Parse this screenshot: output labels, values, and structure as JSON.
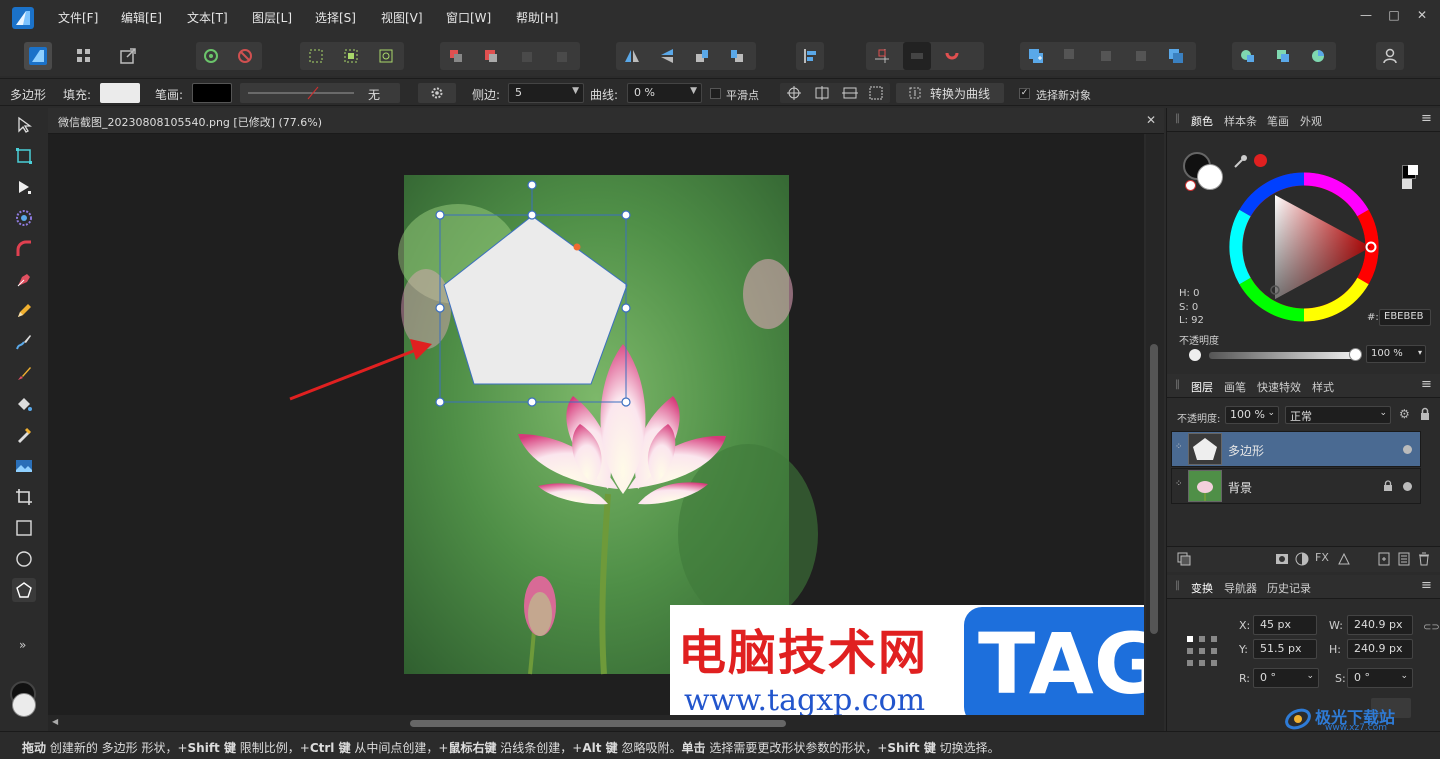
{
  "menubar": {
    "items": [
      "文件[F]",
      "编辑[E]",
      "文本[T]",
      "图层[L]",
      "选择[S]",
      "视图[V]",
      "窗口[W]",
      "帮助[H]"
    ],
    "window_controls": {
      "minimize": "—",
      "maximize": "□",
      "close": "✕"
    }
  },
  "context_bar": {
    "tool_name": "多边形",
    "fill_label": "填充:",
    "stroke_label": "笔画:",
    "stroke_style_value": "无",
    "sides_label": "侧边:",
    "sides_value": "5",
    "curve_label": "曲线:",
    "curve_value": "0 %",
    "smooth_points_label": "平滑点",
    "convert_to_curves_label": "转换为曲线",
    "select_new_object_label": "选择新对象",
    "fill_color": "#ebebeb",
    "stroke_color": "#000000"
  },
  "document": {
    "tab_title": "微信截图_20230808105540.png [已修改] (77.6%)",
    "close_icon": "✕"
  },
  "color_panel": {
    "tabs": [
      "颜色",
      "样本条",
      "笔画",
      "外观"
    ],
    "hsl": {
      "h": "H: 0",
      "s": "S: 0",
      "l": "L: 92"
    },
    "hex_label": "#:",
    "hex_value": "EBEBEB",
    "opacity_label": "不透明度",
    "opacity_value": "100 %",
    "accent": "#e02020"
  },
  "layers_panel": {
    "tabs": [
      "图层",
      "画笔",
      "快速特效",
      "样式"
    ],
    "opacity_label": "不透明度:",
    "opacity_value": "100 %",
    "blend_mode": "正常",
    "layers": [
      {
        "name": "多边形",
        "selected": true
      },
      {
        "name": "背景",
        "selected": false,
        "locked": true
      }
    ]
  },
  "transform_panel": {
    "tabs": [
      "变换",
      "导航器",
      "历史记录"
    ],
    "x_label": "X:",
    "x_value": "45 px",
    "y_label": "Y:",
    "y_value": "51.5 px",
    "w_label": "W:",
    "w_value": "240.9 px",
    "h_label": "H:",
    "h_value": "240.9 px",
    "r_label": "R:",
    "r_value": "0 °",
    "s_label": "S:",
    "s_value": "0 °"
  },
  "status": {
    "parts": [
      {
        "bold": true,
        "text": "拖动"
      },
      {
        "bold": false,
        "text": " 创建新的 多边形 形状，+"
      },
      {
        "bold": true,
        "text": "Shift 键"
      },
      {
        "bold": false,
        "text": " 限制比例，+"
      },
      {
        "bold": true,
        "text": "Ctrl 键"
      },
      {
        "bold": false,
        "text": " 从中间点创建，+"
      },
      {
        "bold": true,
        "text": "鼠标右键"
      },
      {
        "bold": false,
        "text": " 沿线条创建，+"
      },
      {
        "bold": true,
        "text": "Alt 键"
      },
      {
        "bold": false,
        "text": " 忽略吸附。"
      },
      {
        "bold": true,
        "text": "单击"
      },
      {
        "bold": false,
        "text": " 选择需要更改形状参数的形状，+"
      },
      {
        "bold": true,
        "text": "Shift 键"
      },
      {
        "bold": false,
        "text": " 切换选择。"
      }
    ]
  },
  "watermark": {
    "title": "电脑技术网",
    "url": "www.tagxp.com",
    "badge": "TAG",
    "corner_text": "极光下载站",
    "corner_url": "www.xz7.com"
  },
  "left_tools": [
    "move-tool-icon",
    "artboard-tool-icon",
    "node-tool-icon",
    "contour-tool-icon",
    "corner-tool-icon",
    "pen-tool-icon",
    "pencil-tool-icon",
    "vector-brush-icon",
    "paint-brush-icon",
    "fill-tool-icon",
    "transparency-tool-icon",
    "place-image-icon",
    "crop-tool-icon",
    "rectangle-tool-icon",
    "ellipse-tool-icon",
    "polygon-tool-icon"
  ]
}
